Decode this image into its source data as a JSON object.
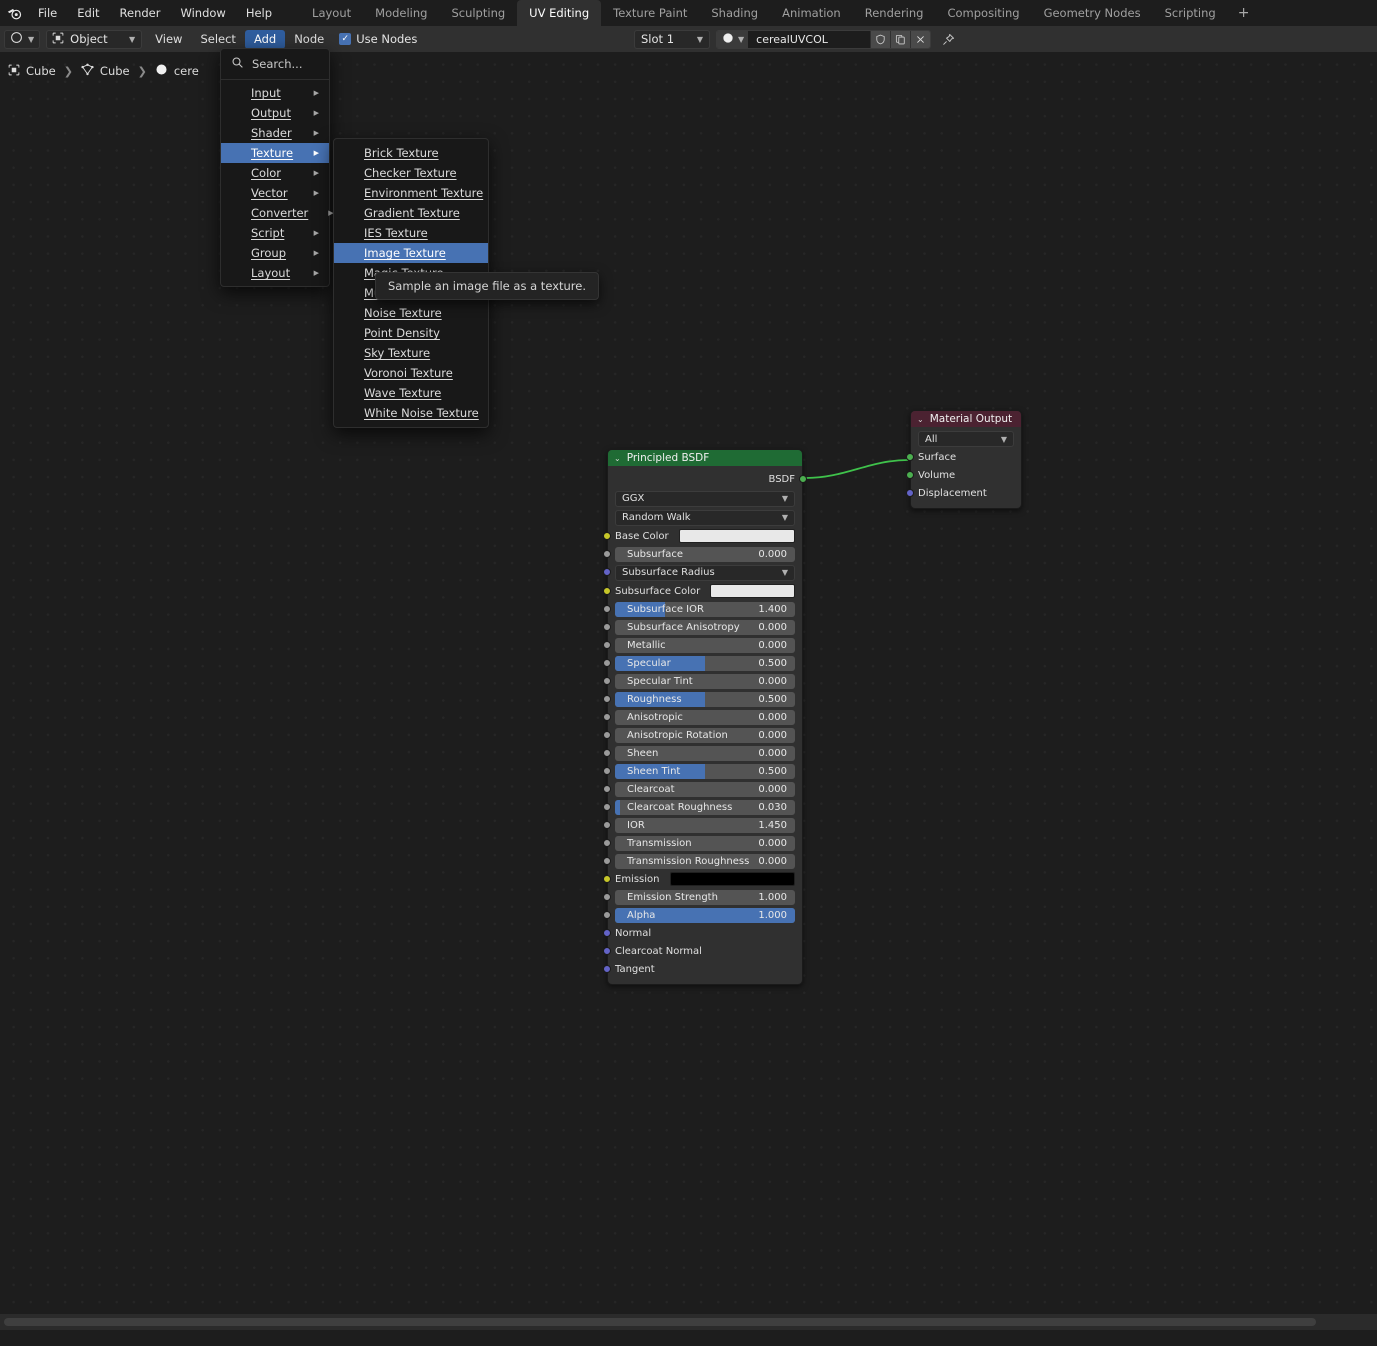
{
  "topbar": {
    "logo_icon": "blender-logo-icon",
    "menus": [
      "File",
      "Edit",
      "Render",
      "Window",
      "Help"
    ],
    "workspace_tabs": [
      {
        "label": "Layout",
        "active": false
      },
      {
        "label": "Modeling",
        "active": false
      },
      {
        "label": "Sculpting",
        "active": false
      },
      {
        "label": "UV Editing",
        "active": true
      },
      {
        "label": "Texture Paint",
        "active": false
      },
      {
        "label": "Shading",
        "active": false
      },
      {
        "label": "Animation",
        "active": false
      },
      {
        "label": "Rendering",
        "active": false
      },
      {
        "label": "Compositing",
        "active": false
      },
      {
        "label": "Geometry Nodes",
        "active": false
      },
      {
        "label": "Scripting",
        "active": false
      }
    ],
    "add_workspace_label": "+"
  },
  "editor_header": {
    "editor_type_icon": "shader-editor-icon",
    "shader_type_icon": "object-icon",
    "shader_type_value": "Object",
    "menus": [
      {
        "label": "View",
        "highlight": false
      },
      {
        "label": "Select",
        "highlight": false
      },
      {
        "label": "Add",
        "highlight": true
      },
      {
        "label": "Node",
        "highlight": false
      }
    ],
    "use_nodes_label": "Use Nodes",
    "use_nodes_checked": true,
    "slot_value": "Slot 1",
    "material_icon": "material-sphere-icon",
    "material_name": "cerealUVCOL",
    "buttons": [
      {
        "icon": "shield-fake-user-icon"
      },
      {
        "icon": "copy-duplicate-icon"
      },
      {
        "icon": "close-x-icon"
      }
    ],
    "pin_icon": "pin-icon"
  },
  "breadcrumb": [
    {
      "icon": "object-icon",
      "label": "Cube"
    },
    {
      "icon": "mesh-data-icon",
      "label": "Cube"
    },
    {
      "icon": "material-sphere-icon",
      "label": "cere"
    }
  ],
  "add_menu": {
    "search_label": "Search...",
    "search_icon": "search-icon",
    "items": [
      {
        "label": "Input",
        "selected": false
      },
      {
        "label": "Output",
        "selected": false
      },
      {
        "label": "Shader",
        "selected": false
      },
      {
        "label": "Texture",
        "selected": true
      },
      {
        "label": "Color",
        "selected": false
      },
      {
        "label": "Vector",
        "selected": false
      },
      {
        "label": "Converter",
        "selected": false
      },
      {
        "label": "Script",
        "selected": false
      },
      {
        "label": "Group",
        "selected": false
      },
      {
        "label": "Layout",
        "selected": false
      }
    ]
  },
  "texture_submenu": {
    "items": [
      {
        "label": "Brick Texture",
        "selected": false
      },
      {
        "label": "Checker Texture",
        "selected": false
      },
      {
        "label": "Environment Texture",
        "selected": false
      },
      {
        "label": "Gradient Texture",
        "selected": false
      },
      {
        "label": "IES Texture",
        "selected": false
      },
      {
        "label": "Image Texture",
        "selected": true
      },
      {
        "label": "Magic Texture",
        "selected": false
      },
      {
        "label": "Musgrave Texture",
        "selected": false
      },
      {
        "label": "Noise Texture",
        "selected": false
      },
      {
        "label": "Point Density",
        "selected": false
      },
      {
        "label": "Sky Texture",
        "selected": false
      },
      {
        "label": "Voronoi Texture",
        "selected": false
      },
      {
        "label": "Wave Texture",
        "selected": false
      },
      {
        "label": "White Noise Texture",
        "selected": false
      }
    ]
  },
  "tooltip": {
    "text": "Sample an image file as a texture."
  },
  "nodes": {
    "principled": {
      "title": "Principled BSDF",
      "header_color": "#1f6b34",
      "output_socket_label": "BSDF",
      "dropdowns": [
        {
          "value": "GGX"
        },
        {
          "value": "Random Walk"
        }
      ],
      "rows": [
        {
          "kind": "color",
          "label": "Base Color",
          "color": "#e8e8e8",
          "socket": "#c7c729"
        },
        {
          "kind": "value",
          "label": "Subsurface",
          "value": "0.000",
          "fill": 0,
          "socket": "#9a9a9a"
        },
        {
          "kind": "dropdown",
          "label": "Subsurface Radius",
          "value": "Subsurface Radius",
          "socket": "#6363c7"
        },
        {
          "kind": "color",
          "label": "Subsurface Color",
          "color": "#e8e8e8",
          "socket": "#c7c729"
        },
        {
          "kind": "value",
          "label": "Subsurface IOR",
          "value": "1.400",
          "fill": 28,
          "socket": "#9a9a9a"
        },
        {
          "kind": "value",
          "label": "Subsurface Anisotropy",
          "value": "0.000",
          "fill": 0,
          "socket": "#9a9a9a"
        },
        {
          "kind": "value",
          "label": "Metallic",
          "value": "0.000",
          "fill": 0,
          "socket": "#9a9a9a"
        },
        {
          "kind": "value",
          "label": "Specular",
          "value": "0.500",
          "fill": 50,
          "socket": "#9a9a9a"
        },
        {
          "kind": "value",
          "label": "Specular Tint",
          "value": "0.000",
          "fill": 0,
          "socket": "#9a9a9a"
        },
        {
          "kind": "value",
          "label": "Roughness",
          "value": "0.500",
          "fill": 50,
          "socket": "#9a9a9a"
        },
        {
          "kind": "value",
          "label": "Anisotropic",
          "value": "0.000",
          "fill": 0,
          "socket": "#9a9a9a"
        },
        {
          "kind": "value",
          "label": "Anisotropic Rotation",
          "value": "0.000",
          "fill": 0,
          "socket": "#9a9a9a"
        },
        {
          "kind": "value",
          "label": "Sheen",
          "value": "0.000",
          "fill": 0,
          "socket": "#9a9a9a"
        },
        {
          "kind": "value",
          "label": "Sheen Tint",
          "value": "0.500",
          "fill": 50,
          "socket": "#9a9a9a"
        },
        {
          "kind": "value",
          "label": "Clearcoat",
          "value": "0.000",
          "fill": 0,
          "socket": "#9a9a9a"
        },
        {
          "kind": "value",
          "label": "Clearcoat Roughness",
          "value": "0.030",
          "fill": 3,
          "socket": "#9a9a9a"
        },
        {
          "kind": "value",
          "label": "IOR",
          "value": "1.450",
          "fill": 0,
          "socket": "#9a9a9a"
        },
        {
          "kind": "value",
          "label": "Transmission",
          "value": "0.000",
          "fill": 0,
          "socket": "#9a9a9a"
        },
        {
          "kind": "value",
          "label": "Transmission Roughness",
          "value": "0.000",
          "fill": 0,
          "socket": "#9a9a9a"
        },
        {
          "kind": "color",
          "label": "Emission",
          "color": "#000000",
          "socket": "#c7c729"
        },
        {
          "kind": "value",
          "label": "Emission Strength",
          "value": "1.000",
          "fill": 0,
          "socket": "#9a9a9a"
        },
        {
          "kind": "value",
          "label": "Alpha",
          "value": "1.000",
          "fill": 100,
          "socket": "#9a9a9a"
        },
        {
          "kind": "name",
          "label": "Normal",
          "socket": "#6363c7"
        },
        {
          "kind": "name",
          "label": "Clearcoat Normal",
          "socket": "#6363c7"
        },
        {
          "kind": "name",
          "label": "Tangent",
          "socket": "#6363c7"
        }
      ]
    },
    "material_output": {
      "title": "Material Output",
      "header_color": "#4b2231",
      "target_value": "All",
      "inputs": [
        {
          "label": "Surface",
          "socket": "#4caf50"
        },
        {
          "label": "Volume",
          "socket": "#4caf50"
        },
        {
          "label": "Displacement",
          "socket": "#6363c7"
        }
      ]
    }
  },
  "link": {
    "color": "#3fc24b",
    "from_label": "BSDF",
    "to_label": "Surface"
  }
}
